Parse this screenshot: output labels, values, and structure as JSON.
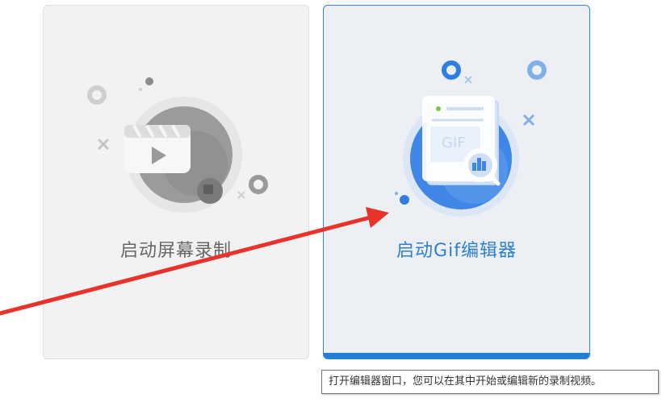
{
  "cards": {
    "record": {
      "label": "启动屏幕录制",
      "icon": "video-clapper-icon"
    },
    "gif_editor": {
      "label": "启动Gif编辑器",
      "icon": "gif-document-icon",
      "doc_text": "GIF"
    }
  },
  "tooltip": {
    "text": "打开编辑器窗口，您可以在其中开始或编辑新的录制视频。"
  },
  "colors": {
    "accent": "#1f7fd9",
    "arrow": "#e8322a",
    "record_label": "#666666",
    "gif_label": "#2e7fd3"
  }
}
